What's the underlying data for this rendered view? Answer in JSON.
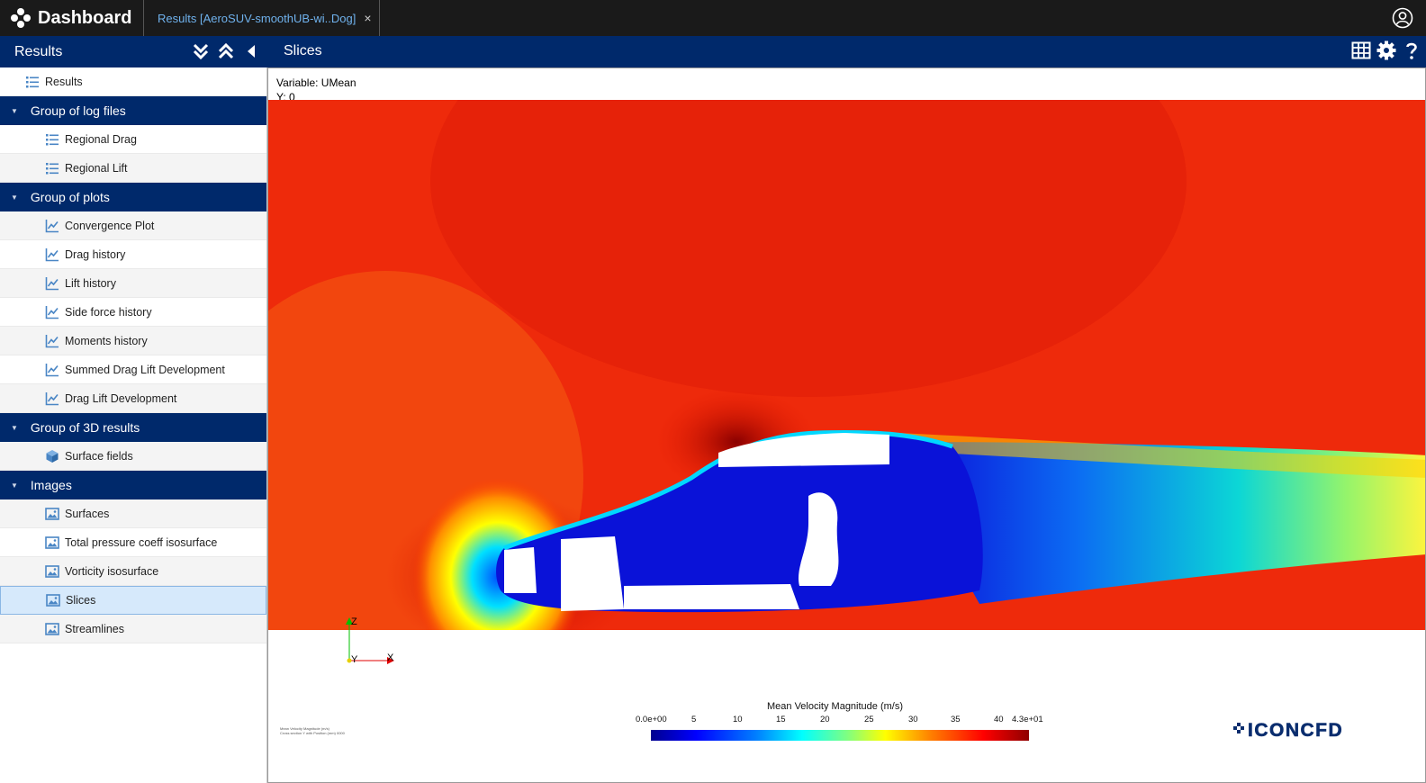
{
  "topbar": {
    "title": "Dashboard",
    "tab_label": "Results [AeroSUV-smoothUB-wi..Dog]",
    "close_glyph": "×"
  },
  "left_panel": {
    "title": "Results"
  },
  "viewer_header": {
    "title": "Slices"
  },
  "tree": {
    "root": "Results",
    "groups": [
      {
        "label": "Group of log files",
        "items": [
          "Regional Drag",
          "Regional Lift"
        ]
      },
      {
        "label": "Group of plots",
        "items": [
          "Convergence Plot",
          "Drag history",
          "Lift history",
          "Side force history",
          "Moments history",
          "Summed Drag Lift Development",
          "Drag Lift Development"
        ]
      },
      {
        "label": "Group of 3D results",
        "items": [
          "Surface fields"
        ]
      },
      {
        "label": "Images",
        "items": [
          "Surfaces",
          "Total pressure coeff isosurface",
          "Vorticity isosurface",
          "Slices",
          "Streamlines"
        ]
      }
    ],
    "selected": "Slices"
  },
  "viewer": {
    "variable": "Variable: UMean",
    "y_position": "Y: 0",
    "axes": {
      "z": "Z",
      "y": "Y",
      "x": "X"
    },
    "legend": {
      "title": "Mean Velocity Magnitude (m/s)",
      "ticks": [
        "0.0e+00",
        "5",
        "10",
        "15",
        "20",
        "25",
        "30",
        "35",
        "40",
        "4.3e+01"
      ]
    },
    "fine_print": [
      "Mean Velocity Magnitude (m/s)",
      "Cross section Y with Position (mm) 0000"
    ],
    "logo_text": "ICONCFD"
  },
  "icons": {
    "brand": "dashboard-logo-icon",
    "user": "user-account-icon",
    "expand_all": "double-chevron-down-icon",
    "collapse_all": "double-chevron-up-icon",
    "collapse_panel": "caret-left-icon",
    "table": "table-grid-icon",
    "settings": "gear-icon",
    "help": "question-mark-icon"
  },
  "colors": {
    "header_bg": "#1a1a1a",
    "section_bg": "#00296b",
    "tab_text": "#6fb1ec",
    "selected_row": "#d6e9fb"
  }
}
